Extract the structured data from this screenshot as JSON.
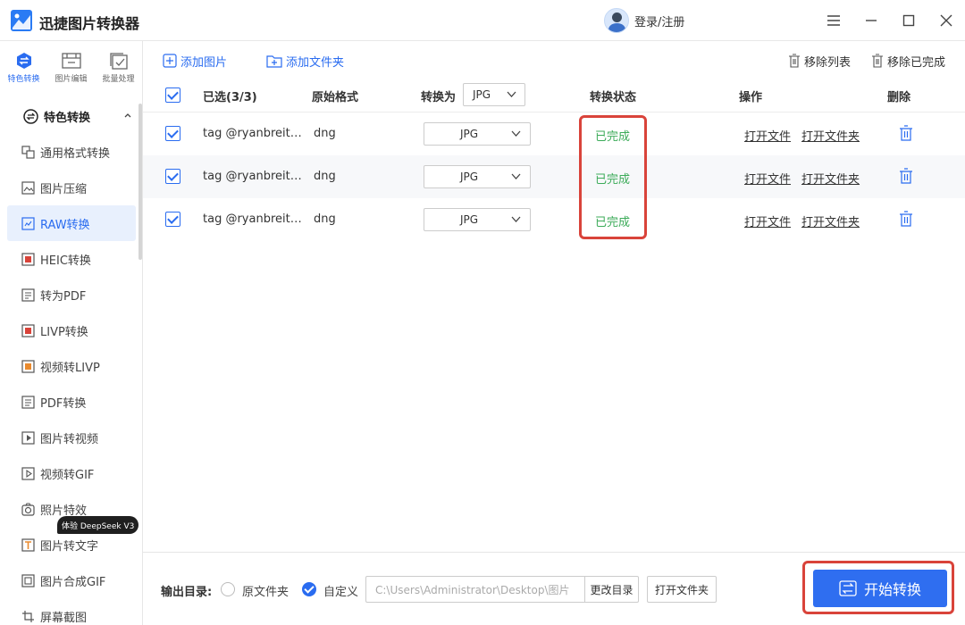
{
  "app": {
    "title": "迅捷图片转换器",
    "login_label": "登录/注册"
  },
  "mode_tabs": [
    {
      "label": "特色转换",
      "active": true
    },
    {
      "label": "图片编辑",
      "active": false
    },
    {
      "label": "批量处理",
      "active": false
    }
  ],
  "sidebar": {
    "section_label": "特色转换",
    "items": [
      {
        "label": "通用格式转换",
        "icon": "convert-icon"
      },
      {
        "label": "图片压缩",
        "icon": "compress-icon"
      },
      {
        "label": "RAW转换",
        "icon": "raw-icon",
        "active": true
      },
      {
        "label": "HEIC转换",
        "icon": "heic-icon"
      },
      {
        "label": "转为PDF",
        "icon": "pdf-icon"
      },
      {
        "label": "LIVP转换",
        "icon": "livp-icon"
      },
      {
        "label": "视频转LIVP",
        "icon": "video-livp-icon"
      },
      {
        "label": "PDF转换",
        "icon": "pdf-convert-icon"
      },
      {
        "label": "图片转视频",
        "icon": "image-video-icon"
      },
      {
        "label": "视频转GIF",
        "icon": "video-gif-icon"
      },
      {
        "label": "照片特效",
        "icon": "effect-icon"
      },
      {
        "label": "图片转文字",
        "icon": "ocr-icon"
      },
      {
        "label": "图片合成GIF",
        "icon": "gif-icon"
      },
      {
        "label": "屏幕截图",
        "icon": "screenshot-icon"
      }
    ],
    "badge": "体验 DeepSeek V3"
  },
  "toolbar": {
    "add_image": "添加图片",
    "add_folder": "添加文件夹",
    "remove_list": "移除列表",
    "remove_done": "移除已完成"
  },
  "table": {
    "headers": {
      "selected": "已选(3/3)",
      "original_format": "原始格式",
      "convert_to": "转换为",
      "convert_to_value": "JPG",
      "status": "转换状态",
      "actions": "操作",
      "delete": "删除"
    },
    "rows": [
      {
        "name": "tag @ryanbreitk...",
        "format": "dng",
        "target": "JPG",
        "status": "已完成",
        "open_file": "打开文件",
        "open_folder": "打开文件夹"
      },
      {
        "name": "tag @ryanbreitk...",
        "format": "dng",
        "target": "JPG",
        "status": "已完成",
        "open_file": "打开文件",
        "open_folder": "打开文件夹"
      },
      {
        "name": "tag @ryanbreitk...",
        "format": "dng",
        "target": "JPG",
        "status": "已完成",
        "open_file": "打开文件",
        "open_folder": "打开文件夹"
      }
    ]
  },
  "output": {
    "label": "输出目录:",
    "option_original": "原文件夹",
    "option_custom": "自定义",
    "path": "C:\\Users\\Administrator\\Desktop\\图片",
    "change_dir": "更改目录",
    "open_folder": "打开文件夹"
  },
  "start_button": "开始转换",
  "colors": {
    "accent": "#2f6ef0",
    "success": "#3cab59",
    "highlight": "#d9433a"
  }
}
